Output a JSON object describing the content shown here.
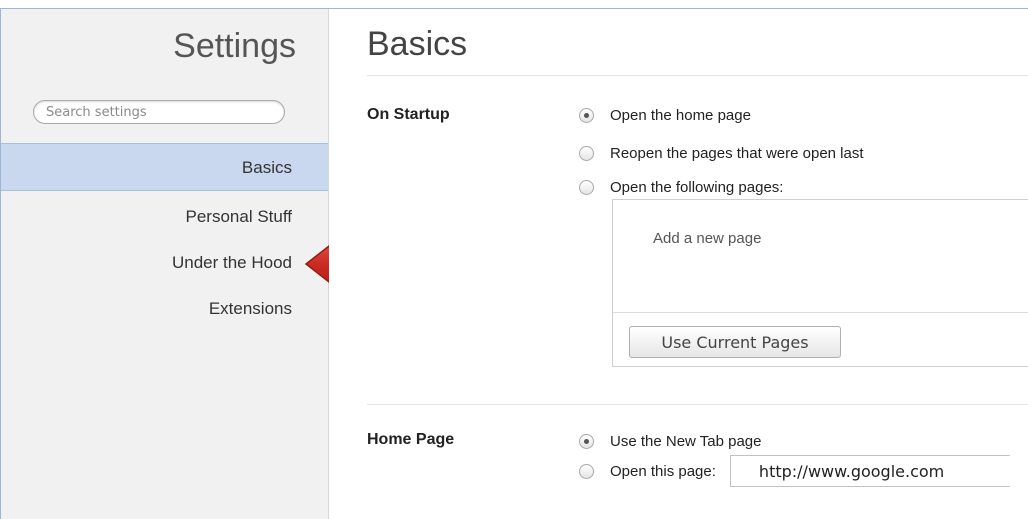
{
  "sidebar": {
    "title": "Settings",
    "search_placeholder": "Search settings",
    "items": [
      {
        "label": "Basics"
      },
      {
        "label": "Personal Stuff"
      },
      {
        "label": "Under the Hood"
      },
      {
        "label": "Extensions"
      }
    ],
    "active_index": 0
  },
  "main": {
    "title": "Basics",
    "on_startup": {
      "label": "On Startup",
      "options": [
        {
          "label": "Open the home page",
          "checked": true
        },
        {
          "label": "Reopen the pages that were open last",
          "checked": false
        },
        {
          "label": "Open the following pages:",
          "checked": false
        }
      ],
      "add_page_label": "Add a new page",
      "use_current_pages_label": "Use Current Pages"
    },
    "home_page": {
      "label": "Home Page",
      "options": [
        {
          "label": "Use the New Tab page",
          "checked": true
        },
        {
          "label": "Open this page:",
          "checked": false
        }
      ],
      "url_value": "http://www.google.com"
    }
  },
  "annotation": {
    "color": "#d0342c",
    "icon": "red-arrow-icon"
  }
}
